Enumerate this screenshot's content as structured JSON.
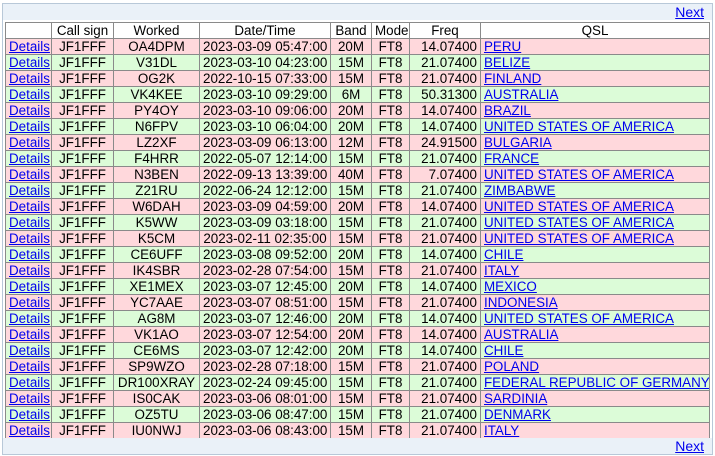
{
  "nav": {
    "next_label": "Next"
  },
  "table": {
    "headers": [
      "",
      "Call sign",
      "Worked",
      "Date/Time",
      "Band",
      "Mode",
      "Freq",
      "QSL"
    ],
    "details_label": "Details",
    "rows": [
      {
        "call": "JF1FFF",
        "worked": "OA4DPM",
        "datetime": "2023-03-09 05:47:00",
        "band": "20M",
        "mode": "FT8",
        "freq": "14.07400",
        "qsl": "PERU",
        "color": "pink"
      },
      {
        "call": "JF1FFF",
        "worked": "V31DL",
        "datetime": "2023-03-10 04:23:00",
        "band": "15M",
        "mode": "FT8",
        "freq": "21.07400",
        "qsl": "BELIZE",
        "color": "green"
      },
      {
        "call": "JF1FFF",
        "worked": "OG2K",
        "datetime": "2022-10-15 07:33:00",
        "band": "15M",
        "mode": "FT8",
        "freq": "21.07400",
        "qsl": "FINLAND",
        "color": "pink"
      },
      {
        "call": "JF1FFF",
        "worked": "VK4KEE",
        "datetime": "2023-03-10 09:29:00",
        "band": "6M",
        "mode": "FT8",
        "freq": "50.31300",
        "qsl": "AUSTRALIA",
        "color": "green"
      },
      {
        "call": "JF1FFF",
        "worked": "PY4OY",
        "datetime": "2023-03-10 09:06:00",
        "band": "20M",
        "mode": "FT8",
        "freq": "14.07400",
        "qsl": "BRAZIL",
        "color": "pink"
      },
      {
        "call": "JF1FFF",
        "worked": "N6FPV",
        "datetime": "2023-03-10 06:04:00",
        "band": "20M",
        "mode": "FT8",
        "freq": "14.07400",
        "qsl": "UNITED STATES OF AMERICA",
        "color": "green"
      },
      {
        "call": "JF1FFF",
        "worked": "LZ2XF",
        "datetime": "2023-03-09 06:13:00",
        "band": "12M",
        "mode": "FT8",
        "freq": "24.91500",
        "qsl": "BULGARIA",
        "color": "pink"
      },
      {
        "call": "JF1FFF",
        "worked": "F4HRR",
        "datetime": "2022-05-07 12:14:00",
        "band": "15M",
        "mode": "FT8",
        "freq": "21.07400",
        "qsl": "FRANCE",
        "color": "green"
      },
      {
        "call": "JF1FFF",
        "worked": "N3BEN",
        "datetime": "2022-09-13 13:39:00",
        "band": "40M",
        "mode": "FT8",
        "freq": "7.07400",
        "qsl": "UNITED STATES OF AMERICA",
        "color": "pink"
      },
      {
        "call": "JF1FFF",
        "worked": "Z21RU",
        "datetime": "2022-06-24 12:12:00",
        "band": "15M",
        "mode": "FT8",
        "freq": "21.07400",
        "qsl": "ZIMBABWE",
        "color": "green"
      },
      {
        "call": "JF1FFF",
        "worked": "W6DAH",
        "datetime": "2023-03-09 04:59:00",
        "band": "20M",
        "mode": "FT8",
        "freq": "14.07400",
        "qsl": "UNITED STATES OF AMERICA",
        "color": "pink"
      },
      {
        "call": "JF1FFF",
        "worked": "K5WW",
        "datetime": "2023-03-09 03:18:00",
        "band": "15M",
        "mode": "FT8",
        "freq": "21.07400",
        "qsl": "UNITED STATES OF AMERICA",
        "color": "green"
      },
      {
        "call": "JF1FFF",
        "worked": "K5CM",
        "datetime": "2023-02-11 02:35:00",
        "band": "15M",
        "mode": "FT8",
        "freq": "21.07400",
        "qsl": "UNITED STATES OF AMERICA",
        "color": "pink"
      },
      {
        "call": "JF1FFF",
        "worked": "CE6UFF",
        "datetime": "2023-03-08 09:52:00",
        "band": "20M",
        "mode": "FT8",
        "freq": "14.07400",
        "qsl": "CHILE",
        "color": "green"
      },
      {
        "call": "JF1FFF",
        "worked": "IK4SBR",
        "datetime": "2023-02-28 07:54:00",
        "band": "15M",
        "mode": "FT8",
        "freq": "21.07400",
        "qsl": "ITALY",
        "color": "pink"
      },
      {
        "call": "JF1FFF",
        "worked": "XE1MEX",
        "datetime": "2023-03-07 12:45:00",
        "band": "20M",
        "mode": "FT8",
        "freq": "14.07400",
        "qsl": "MEXICO",
        "color": "green"
      },
      {
        "call": "JF1FFF",
        "worked": "YC7AAE",
        "datetime": "2023-03-07 08:51:00",
        "band": "15M",
        "mode": "FT8",
        "freq": "21.07400",
        "qsl": "INDONESIA",
        "color": "pink"
      },
      {
        "call": "JF1FFF",
        "worked": "AG8M",
        "datetime": "2023-03-07 12:46:00",
        "band": "20M",
        "mode": "FT8",
        "freq": "14.07400",
        "qsl": "UNITED STATES OF AMERICA",
        "color": "green"
      },
      {
        "call": "JF1FFF",
        "worked": "VK1AO",
        "datetime": "2023-03-07 12:54:00",
        "band": "20M",
        "mode": "FT8",
        "freq": "14.07400",
        "qsl": "AUSTRALIA",
        "color": "pink"
      },
      {
        "call": "JF1FFF",
        "worked": "CE6MS",
        "datetime": "2023-03-07 12:42:00",
        "band": "20M",
        "mode": "FT8",
        "freq": "14.07400",
        "qsl": "CHILE",
        "color": "green"
      },
      {
        "call": "JF1FFF",
        "worked": "SP9WZO",
        "datetime": "2023-02-28 07:18:00",
        "band": "15M",
        "mode": "FT8",
        "freq": "21.07400",
        "qsl": "POLAND",
        "color": "pink"
      },
      {
        "call": "JF1FFF",
        "worked": "DR100XRAY",
        "datetime": "2023-02-24 09:45:00",
        "band": "15M",
        "mode": "FT8",
        "freq": "21.07400",
        "qsl": "FEDERAL REPUBLIC OF GERMANY",
        "color": "green"
      },
      {
        "call": "JF1FFF",
        "worked": "IS0CAK",
        "datetime": "2023-03-06 08:01:00",
        "band": "15M",
        "mode": "FT8",
        "freq": "21.07400",
        "qsl": "SARDINIA",
        "color": "pink"
      },
      {
        "call": "JF1FFF",
        "worked": "OZ5TU",
        "datetime": "2023-03-06 08:47:00",
        "band": "15M",
        "mode": "FT8",
        "freq": "21.07400",
        "qsl": "DENMARK",
        "color": "green"
      },
      {
        "call": "JF1FFF",
        "worked": "IU0NWJ",
        "datetime": "2023-03-06 08:43:00",
        "band": "15M",
        "mode": "FT8",
        "freq": "21.07400",
        "qsl": "ITALY",
        "color": "pink"
      }
    ]
  },
  "colors": {
    "pink_row": "#ffd8dc",
    "green_row": "#dcfcd8",
    "link": "#0000ee",
    "nav_bar": "#eaf1f8"
  }
}
